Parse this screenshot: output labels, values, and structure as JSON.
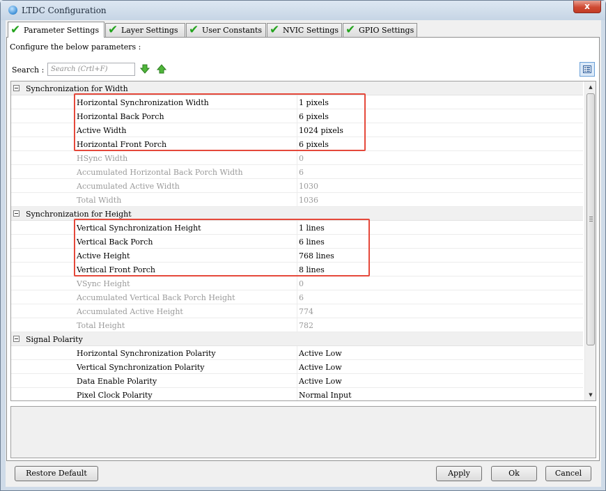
{
  "window": {
    "title": "LTDC Configuration",
    "close_label": "x"
  },
  "tabs": [
    {
      "label": "Parameter Settings",
      "active": true
    },
    {
      "label": "Layer Settings"
    },
    {
      "label": "User Constants"
    },
    {
      "label": "NVIC Settings"
    },
    {
      "label": "GPIO Settings"
    }
  ],
  "hint": "Configure the below parameters :",
  "search": {
    "label": "Search :",
    "placeholder": "Search (Crtl+F)",
    "value": ""
  },
  "icons": {
    "app": "cube-icon",
    "tab_status": "check-icon",
    "search_down": "arrow-down-icon",
    "search_up": "arrow-up-icon",
    "view_toggle": "list-view-icon"
  },
  "colors": {
    "highlight": "#e5483a",
    "check": "#25a41f",
    "disabled_text": "#9a9a9a"
  },
  "groups": [
    {
      "title": "Synchronization for Width",
      "params": [
        {
          "name": "Horizontal Synchronization Width",
          "value": "1 pixels"
        },
        {
          "name": "Horizontal Back Porch",
          "value": "6 pixels"
        },
        {
          "name": "Active Width",
          "value": "1024 pixels"
        },
        {
          "name": "Horizontal Front Porch",
          "value": "6 pixels"
        },
        {
          "name": "HSync Width",
          "value": "0",
          "disabled": true
        },
        {
          "name": "Accumulated Horizontal Back Porch Width",
          "value": "6",
          "disabled": true
        },
        {
          "name": "Accumulated Active Width",
          "value": "1030",
          "disabled": true
        },
        {
          "name": "Total Width",
          "value": "1036",
          "disabled": true
        }
      ]
    },
    {
      "title": "Synchronization for Height",
      "params": [
        {
          "name": "Vertical Synchronization Height",
          "value": "1 lines"
        },
        {
          "name": "Vertical Back Porch",
          "value": "6 lines"
        },
        {
          "name": "Active Height",
          "value": "768 lines"
        },
        {
          "name": "Vertical Front Porch",
          "value": "8 lines"
        },
        {
          "name": "VSync Height",
          "value": "0",
          "disabled": true
        },
        {
          "name": "Accumulated Vertical Back Porch Height",
          "value": "6",
          "disabled": true
        },
        {
          "name": "Accumulated Active Height",
          "value": "774",
          "disabled": true
        },
        {
          "name": "Total Height",
          "value": "782",
          "disabled": true
        }
      ]
    },
    {
      "title": "Signal Polarity",
      "params": [
        {
          "name": "Horizontal Synchronization Polarity",
          "value": "Active Low"
        },
        {
          "name": "Vertical Synchronization Polarity",
          "value": "Active Low"
        },
        {
          "name": "Data Enable Polarity",
          "value": "Active Low"
        },
        {
          "name": "Pixel Clock Polarity",
          "value": "Normal Input"
        }
      ]
    }
  ],
  "buttons": {
    "restore": "Restore Default",
    "apply": "Apply",
    "ok": "Ok",
    "cancel": "Cancel"
  }
}
